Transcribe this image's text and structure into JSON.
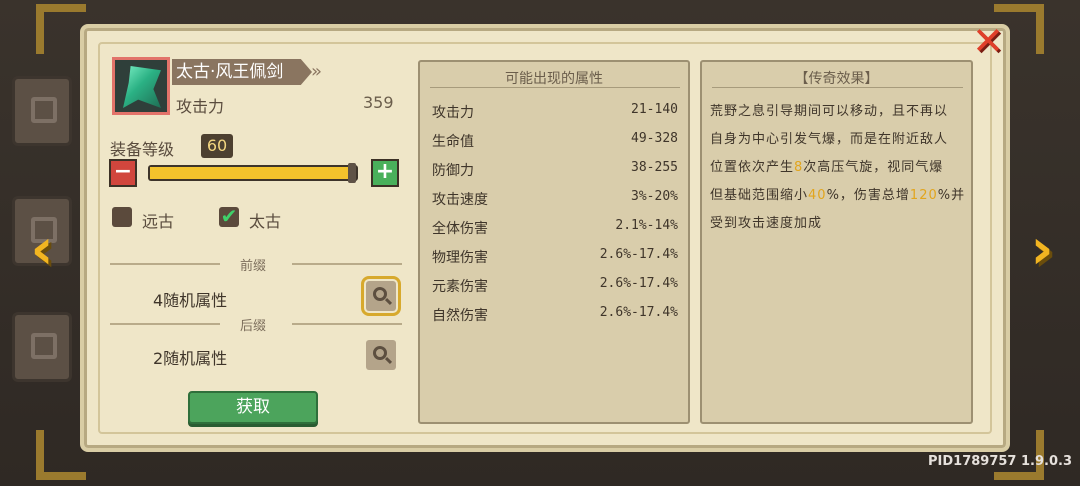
{
  "weapon": {
    "name": "太古·风王佩剑",
    "stat_label": "攻击力",
    "stat_value": "359"
  },
  "level": {
    "label": "装备等级",
    "value": "60",
    "fill": 0.98
  },
  "grades": [
    {
      "label": "远古",
      "checked": false
    },
    {
      "label": "太古",
      "checked": true
    }
  ],
  "prefix": {
    "title": "前缀",
    "text": "4随机属性"
  },
  "suffix": {
    "title": "后缀",
    "text": "2随机属性"
  },
  "get_button": "获取",
  "attributes": {
    "title": "可能出现的属性",
    "rows": [
      {
        "name": "攻击力",
        "range": "21-140"
      },
      {
        "name": "生命值",
        "range": "49-328"
      },
      {
        "name": "防御力",
        "range": "38-255"
      },
      {
        "name": "攻击速度",
        "range": "3%-20%"
      },
      {
        "name": "全体伤害",
        "range": "2.1%-14%"
      },
      {
        "name": "物理伤害",
        "range": "2.6%-17.4%"
      },
      {
        "name": "元素伤害",
        "range": "2.6%-17.4%"
      },
      {
        "name": "自然伤害",
        "range": "2.6%-17.4%"
      }
    ]
  },
  "legend": {
    "title": "【传奇效果】",
    "lines": [
      [
        "荒野之息引导期间可以移动，且不再以"
      ],
      [
        "自身为中心引发气爆，而是在附近敌人"
      ],
      [
        "位置依次产生",
        "8",
        "次高压气旋，视同气爆"
      ],
      [
        "但基础范围缩小",
        "40",
        "%，伤害总增",
        "120",
        "%并"
      ],
      [
        "受到攻击速度加成"
      ]
    ]
  },
  "footer": {
    "pid": "PID1789757 1.9.0.3"
  },
  "colors": {
    "accent_gold": "#f2b521",
    "highlight": "#e2a51d",
    "close_red": "#e0402a"
  },
  "icons": [
    "close-icon",
    "arrow-left-icon",
    "arrow-right-icon",
    "minus-icon",
    "plus-icon",
    "check-icon",
    "search-icon"
  ]
}
